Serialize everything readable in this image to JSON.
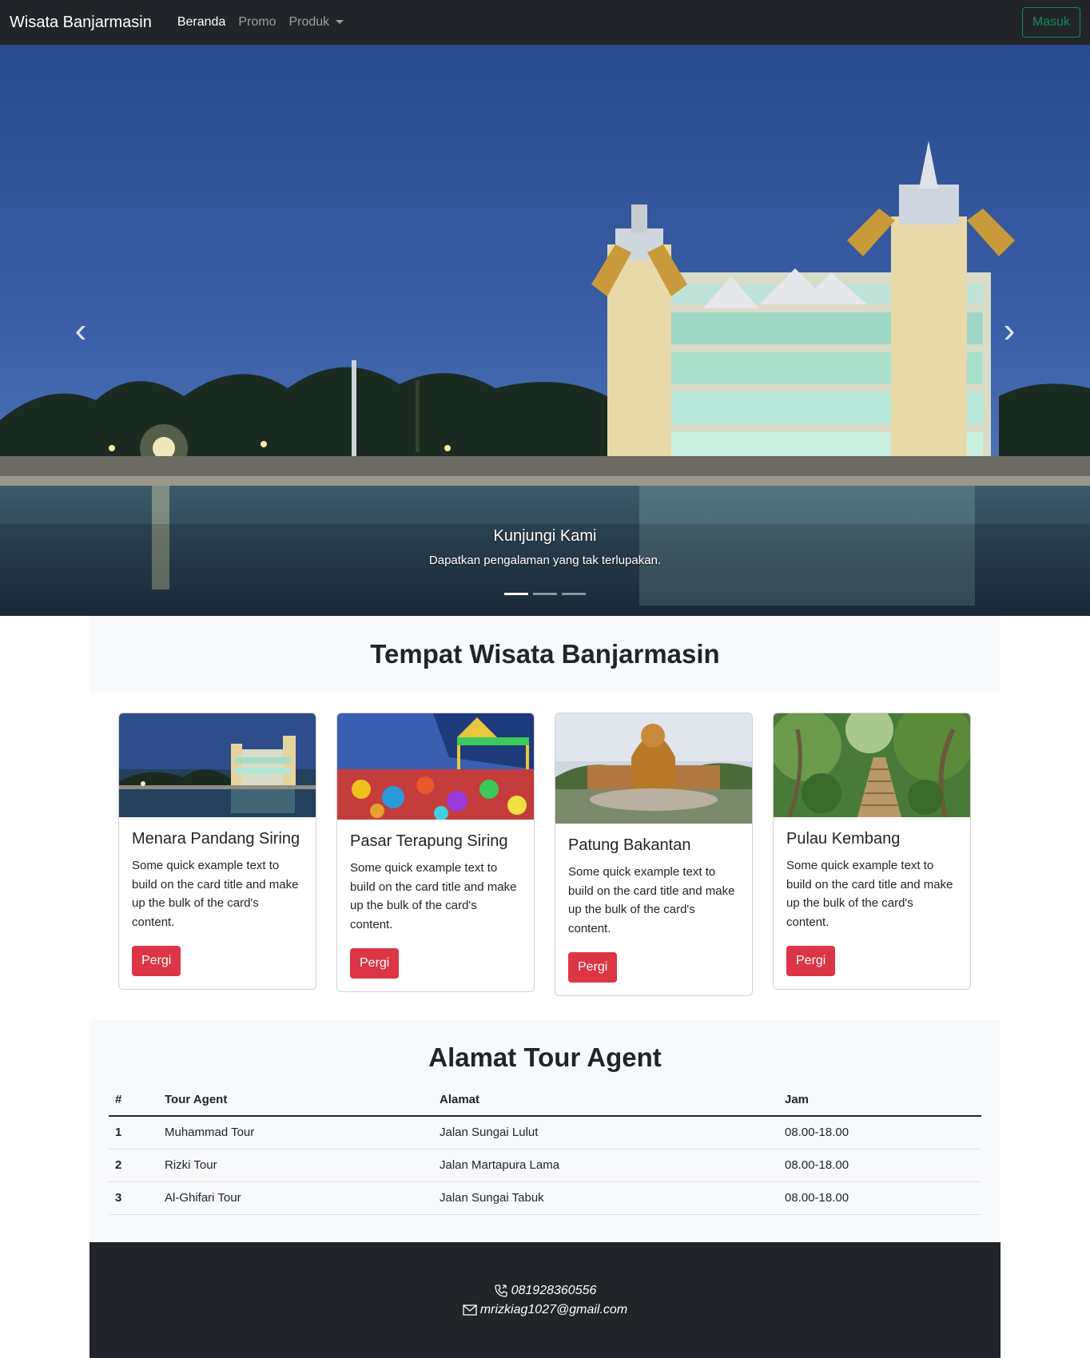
{
  "navbar": {
    "brand": "Wisata Banjarmasin",
    "links": [
      "Beranda",
      "Promo",
      "Produk"
    ],
    "login_label": "Masuk"
  },
  "hero": {
    "caption_title": "Kunjungi Kami",
    "caption_text": "Dapatkan pengalaman yang tak terlupakan.",
    "slides_count": 3,
    "active_slide": 1
  },
  "destinations": {
    "heading": "Tempat Wisata Banjarmasin",
    "cards": [
      {
        "title": "Menara Pandang Siring",
        "text": "Some quick example text to build on the card title and make up the bulk of the card's content.",
        "button": "Pergi"
      },
      {
        "title": "Pasar Terapung Siring",
        "text": "Some quick example text to build on the card title and make up the bulk of the card's content.",
        "button": "Pergi"
      },
      {
        "title": "Patung Bakantan",
        "text": "Some quick example text to build on the card title and make up the bulk of the card's content.",
        "button": "Pergi"
      },
      {
        "title": "Pulau Kembang",
        "text": "Some quick example text to build on the card title and make up the bulk of the card's content.",
        "button": "Pergi"
      }
    ]
  },
  "agents": {
    "heading": "Alamat Tour Agent",
    "columns": [
      "#",
      "Tour Agent",
      "Alamat",
      "Jam"
    ],
    "rows": [
      [
        "1",
        "Muhammad Tour",
        "Jalan Sungai Lulut",
        "08.00-18.00"
      ],
      [
        "2",
        "Rizki Tour",
        "Jalan Martapura Lama",
        "08.00-18.00"
      ],
      [
        "3",
        "Al-Ghifari Tour",
        "Jalan Sungai Tabuk",
        "08.00-18.00"
      ]
    ]
  },
  "footer": {
    "phone": "081928360556",
    "email": "mrizkiag1027@gmail.com"
  },
  "colors": {
    "dark": "#212529",
    "light": "#f8f9fa",
    "danger": "#dc3545",
    "success": "#198754"
  }
}
